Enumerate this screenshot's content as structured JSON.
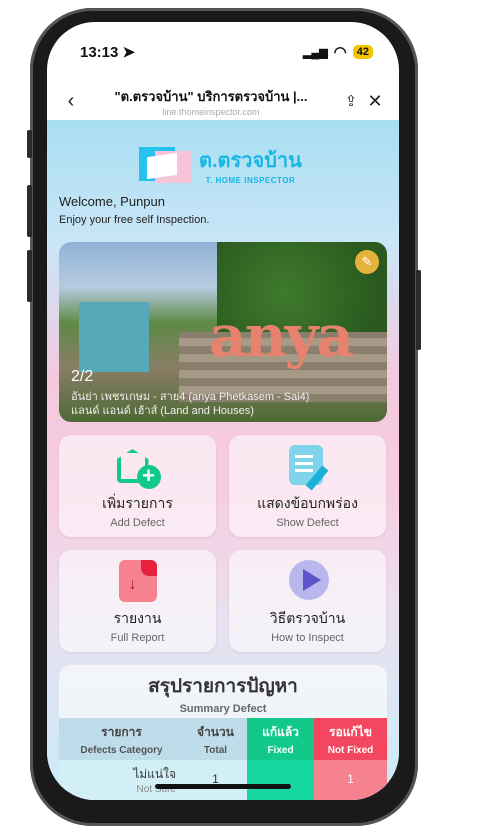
{
  "status": {
    "time": "13:13",
    "battery": "42"
  },
  "navbar": {
    "title": "\"ต.ตรวจบ้าน\" บริการตรวจบ้าน |...",
    "url": "line.thomeinspector.com"
  },
  "logo": {
    "th": "ต.ตรวจบ้าน",
    "en": "T. HOME INSPECTOR"
  },
  "welcome": "Welcome, Punpun",
  "enjoy": "Enjoy your free self Inspection.",
  "hero": {
    "brand": "anya",
    "counter": "2/2",
    "line1": "อันย่า เพชรเกษม - สาย4 (anya Phetkasem - Sai4)",
    "line2": "แลนด์ แอนด์ เฮ้าส์ (Land and Houses)"
  },
  "tiles": [
    {
      "th": "เพิ่มรายการ",
      "en": "Add Defect"
    },
    {
      "th": "แสดงข้อบกพร่อง",
      "en": "Show Defect"
    },
    {
      "th": "รายงาน",
      "en": "Full Report"
    },
    {
      "th": "วิธีตรวจบ้าน",
      "en": "How to Inspect"
    }
  ],
  "summary": {
    "title": "สรุปรายการปัญหา",
    "subtitle": "Summary Defect",
    "headers": [
      {
        "th": "รายการ",
        "en": "Defects Category"
      },
      {
        "th": "จำนวน",
        "en": "Total"
      },
      {
        "th": "แก้แล้ว",
        "en": "Fixed"
      },
      {
        "th": "รอแก้ไข",
        "en": "Not Fixed"
      }
    ],
    "rows": [
      {
        "th": "ไม่แน่ใจ",
        "en": "Not Sure",
        "total": "1",
        "fixed": "",
        "not_fixed": "1"
      }
    ]
  },
  "colors": {
    "fixed": "#12c98a",
    "not_fixed": "#f3475f",
    "brand": "#16b6e6"
  }
}
